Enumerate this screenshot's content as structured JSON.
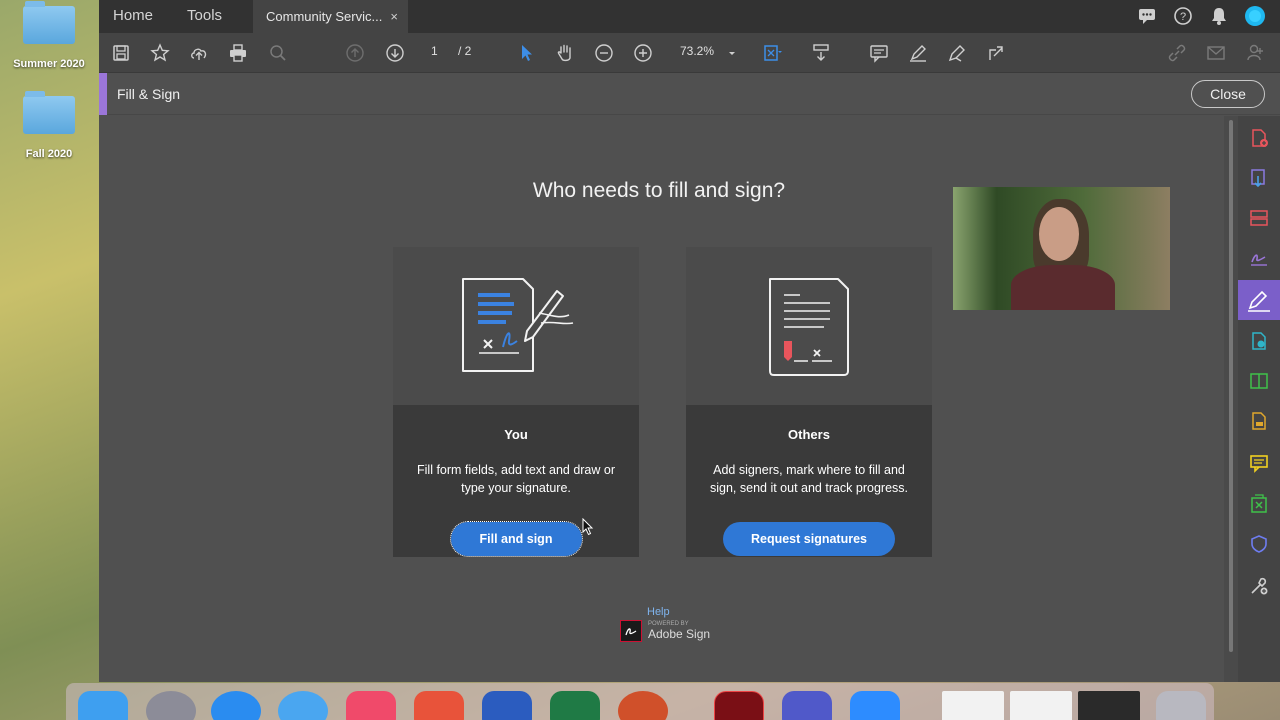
{
  "desktop": {
    "folders": [
      {
        "label": "Summer 2020"
      },
      {
        "label": "Fall 2020"
      }
    ]
  },
  "tabs": {
    "home": "Home",
    "tools": "Tools",
    "document": "Community Servic...",
    "close_symbol": "×"
  },
  "toolbar": {
    "page_current": "1",
    "page_total": "/ 2",
    "zoom": "73.2%"
  },
  "panel": {
    "title": "Fill & Sign",
    "close": "Close"
  },
  "content": {
    "heading": "Who needs to fill and sign?",
    "you": {
      "title": "You",
      "description": "Fill form fields, add text and draw or type your signature.",
      "button": "Fill and sign"
    },
    "others": {
      "title": "Others",
      "description": "Add signers, mark where to fill and sign, send it out and track progress.",
      "button": "Request signatures"
    },
    "help": "Help",
    "powered_by": "POWERED BY",
    "adobe_sign": "Adobe Sign"
  },
  "colors": {
    "accent_purple": "#9b76d9",
    "button_blue": "#2f78d6"
  }
}
